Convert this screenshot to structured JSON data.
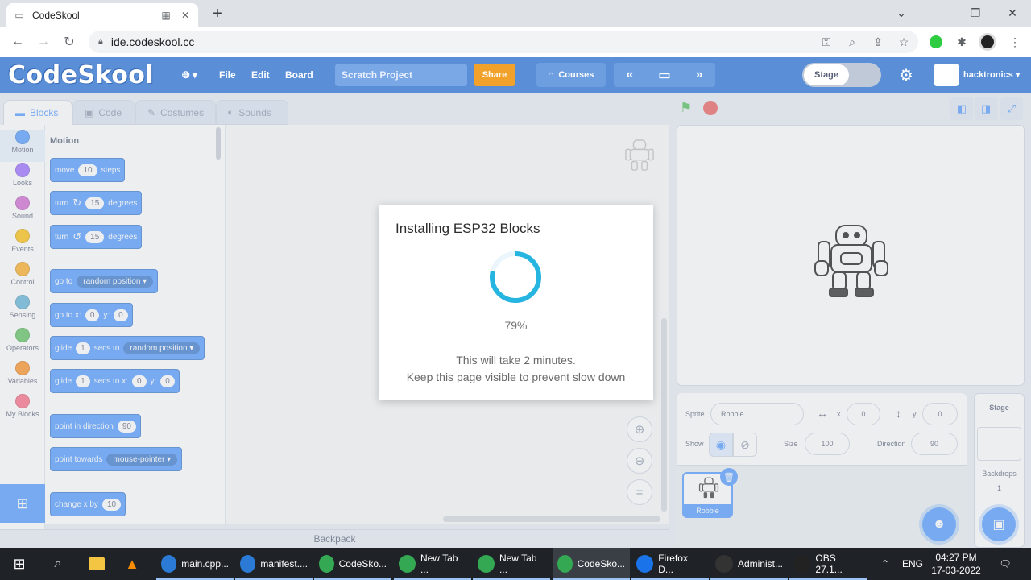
{
  "browser": {
    "tab_title": "CodeSkool",
    "url": "ide.codeskool.cc"
  },
  "app": {
    "logo": "CodeSkool",
    "menu": [
      "File",
      "Edit",
      "Board"
    ],
    "project_placeholder": "Scratch Project",
    "share_label": "Share",
    "courses_label": "Courses",
    "mode_label": "Stage",
    "username": "hacktronics"
  },
  "editor_tabs": [
    "Blocks",
    "Code",
    "Costumes",
    "Sounds"
  ],
  "categories": [
    {
      "label": "Motion",
      "color": "#4c97ff"
    },
    {
      "label": "Looks",
      "color": "#9966ff"
    },
    {
      "label": "Sound",
      "color": "#cf63cf"
    },
    {
      "label": "Events",
      "color": "#ffbf00"
    },
    {
      "label": "Control",
      "color": "#ffab19"
    },
    {
      "label": "Sensing",
      "color": "#5cb1d6"
    },
    {
      "label": "Operators",
      "color": "#59c059"
    },
    {
      "label": "Variables",
      "color": "#ff8c1a"
    },
    {
      "label": "My Blocks",
      "color": "#ff6680"
    }
  ],
  "palette": {
    "header": "Motion",
    "blocks": {
      "move": {
        "a": "move",
        "v": "10",
        "b": "steps"
      },
      "turn_right": {
        "a": "turn",
        "v": "15",
        "b": "degrees"
      },
      "turn_left": {
        "a": "turn",
        "v": "15",
        "b": "degrees"
      },
      "goto": {
        "a": "go to",
        "d": "random position ▾"
      },
      "goto_xy": {
        "a": "go to x:",
        "v1": "0",
        "b": "y:",
        "v2": "0"
      },
      "glide_to": {
        "a": "glide",
        "v": "1",
        "b": "secs to",
        "d": "random position ▾"
      },
      "glide_xy": {
        "a": "glide",
        "v": "1",
        "b": "secs to x:",
        "v1": "0",
        "c": "y:",
        "v2": "0"
      },
      "point_dir": {
        "a": "point in direction",
        "v": "90"
      },
      "point_towards": {
        "a": "point towards",
        "d": "mouse-pointer ▾"
      },
      "change_x": {
        "a": "change x by",
        "v": "10"
      }
    }
  },
  "backpack_label": "Backpack",
  "sprite_info": {
    "sprite_label": "Sprite",
    "sprite_name": "Robbie",
    "x_label": "x",
    "x_value": "0",
    "y_label": "y",
    "y_value": "0",
    "show_label": "Show",
    "size_label": "Size",
    "size_value": "100",
    "direction_label": "Direction",
    "direction_value": "90"
  },
  "sprite_thumb_name": "Robbie",
  "stage_panel": {
    "title": "Stage",
    "backdrops_label": "Backdrops",
    "backdrops_count": "1"
  },
  "modal": {
    "title": "Installing ESP32 Blocks",
    "progress": 0.79,
    "percent_text": "79%",
    "line1": "This will take 2 minutes.",
    "line2": "Keep this page visible to prevent slow down"
  },
  "taskbar": {
    "items": [
      {
        "label": "main.cpp...",
        "icon": "vscode-icon",
        "color": "#2b7bd6"
      },
      {
        "label": "manifest....",
        "icon": "vscode-icon",
        "color": "#2b7bd6"
      },
      {
        "label": "CodeSko...",
        "icon": "chrome-icon",
        "color": "#34a853"
      },
      {
        "label": "New Tab ...",
        "icon": "chrome-icon",
        "color": "#34a853"
      },
      {
        "label": "New Tab ...",
        "icon": "chrome-icon",
        "color": "#34a853"
      },
      {
        "label": "CodeSko...",
        "icon": "chrome-icon",
        "color": "#34a853"
      },
      {
        "label": "Firefox D...",
        "icon": "firefox-icon",
        "color": "#1a73e8"
      },
      {
        "label": "Administ...",
        "icon": "terminal-icon",
        "color": "#333333"
      },
      {
        "label": "OBS 27.1...",
        "icon": "obs-icon",
        "color": "#222222"
      }
    ],
    "lang": "ENG",
    "time": "04:27 PM",
    "date": "17-03-2022"
  }
}
